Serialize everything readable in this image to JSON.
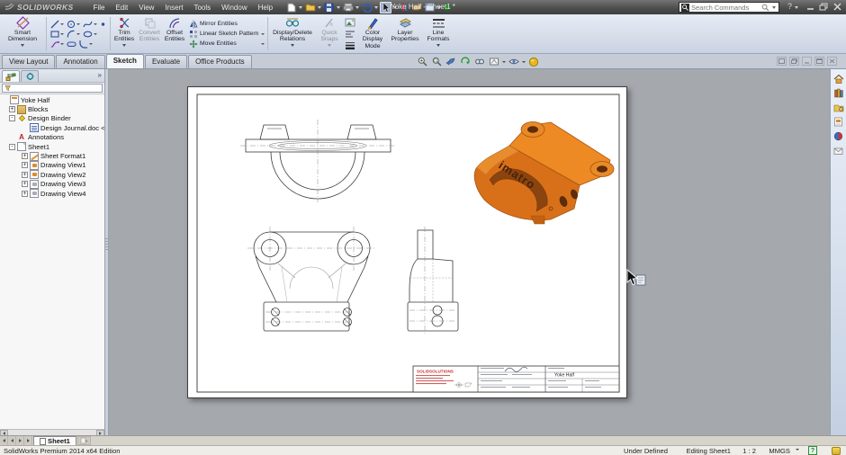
{
  "titlebar": {
    "logo_text": "SOLIDWORKS",
    "menus": [
      "File",
      "Edit",
      "View",
      "Insert",
      "Tools",
      "Window",
      "Help"
    ],
    "title": "Yoke Half - Sheet1 *",
    "search_placeholder": "Search Commands"
  },
  "ribbon": {
    "smart_dimension": "Smart Dimension",
    "trim_entities": "Trim Entities",
    "convert_entities": "Convert Entities",
    "offset_entities": "Offset Entities",
    "mirror_entities": "Mirror Entities",
    "linear_sketch_pattern": "Linear Sketch Pattern",
    "move_entities": "Move Entities",
    "display_delete_relations": "Display/Delete Relations",
    "quick_snaps": "Quick Snaps",
    "color_display_mode": "Color Display Mode",
    "layer_properties": "Layer Properties",
    "line_formats": "Line Formats"
  },
  "tabs": [
    {
      "label": "View Layout"
    },
    {
      "label": "Annotation"
    },
    {
      "label": "Sketch"
    },
    {
      "label": "Evaluate"
    },
    {
      "label": "Office Products"
    }
  ],
  "feature_tree": {
    "items": [
      {
        "label": "Yoke Half",
        "expander": ""
      },
      {
        "label": "Blocks",
        "expander": "+"
      },
      {
        "label": "Design Binder",
        "expander": "-"
      },
      {
        "label": "Design Journal.doc <Emp",
        "expander": ""
      },
      {
        "label": "Annotations",
        "expander": ""
      },
      {
        "label": "Sheet1",
        "expander": "-"
      },
      {
        "label": "Sheet Format1",
        "expander": "+"
      },
      {
        "label": "Drawing View1",
        "expander": "+"
      },
      {
        "label": "Drawing View2",
        "expander": "+"
      },
      {
        "label": "Drawing View3",
        "expander": "+"
      },
      {
        "label": "Drawing View4",
        "expander": "+"
      }
    ]
  },
  "drawing": {
    "part_brand_text": "imatro",
    "titleblock": {
      "logo": "SOLIDSOLUTIONS",
      "title": "Yoke Half"
    }
  },
  "sheetbar": {
    "tab_label": "Sheet1"
  },
  "statusbar": {
    "app_version": "SolidWorks Premium 2014 x64 Edition",
    "constraint_status": "Under Defined",
    "editing": "Editing Sheet1",
    "scale": "1 : 2",
    "units": "MMGS"
  },
  "icon_glyphs": {
    "annotations": "A",
    "question": "?",
    "chevrons": "»"
  },
  "colors": {
    "accent_orange": "#d8701a",
    "icon_blue": "#2f4f9e",
    "brand_red": "#c03030"
  }
}
